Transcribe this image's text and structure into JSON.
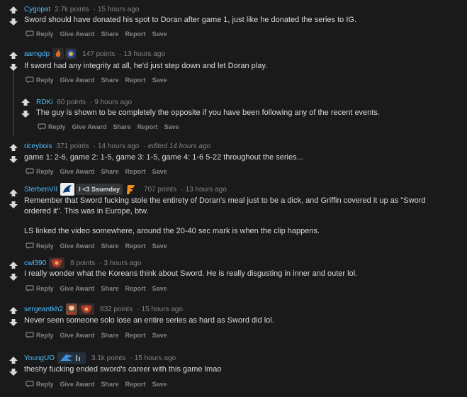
{
  "action_labels": [
    "Reply",
    "Give Award",
    "Share",
    "Report",
    "Save"
  ],
  "colors": {
    "bg": "#1a1a1b",
    "author": "#4fbcff",
    "meta": "#818384",
    "text": "#d7dadc"
  },
  "comments": [
    {
      "author": "Cygopat",
      "points": "2.7k points",
      "time": "15 hours ago",
      "text": "Sword should have donated his spot to Doran after game 1, just like he donated the series to IG.",
      "flairs": []
    },
    {
      "author": "aamgdp",
      "points": "147 points",
      "time": "13 hours ago",
      "text": "If sword had any integrity at all, he'd just step down and let Doran play.",
      "flairs": [
        "fire-team-icon",
        "blue-team-icon"
      ]
    },
    {
      "author": "RDKi",
      "points": "60 points",
      "time": "9 hours ago",
      "text": "The guy is shown to be completely the opposite if you have been following any of the recent events.",
      "flairs": []
    },
    {
      "author": "riceybois",
      "points": "371 points",
      "time": "14 hours ago",
      "edited": "edited 14 hours ago",
      "text": "game 1: 2-6, game 2: 1-5, game 3: 1-5, game 4: 1-6 5-22 throughout the series...",
      "flairs": []
    },
    {
      "author": "SterbenVII",
      "points": "707 points",
      "time": "13 hours ago",
      "flair_text": "I <3 Ssumday",
      "text": "Remember that Sword fucking stole the entirety of Doran's meal just to be a dick, and Griffin covered it up as \"Sword",
      "text2": "ordered it\". This was in Europe, btw.",
      "text3": "LS linked the video somewhere, around the 20-40 sec mark is when the clip happens.",
      "flairs": [
        "liquid-icon",
        "fnatic-icon"
      ]
    },
    {
      "author": "cwl390",
      "points": "8 points",
      "time": "3 hours ago",
      "text": "I really wonder what the Koreans think about Sword. He is really disgusting in inner and outer lol.",
      "flairs": [
        "lck-icon"
      ]
    },
    {
      "author": "sergeantkh2",
      "points": "832 points",
      "time": "15 hours ago",
      "text": "Never seen someone solo lose an entire series as hard as Sword did lol.",
      "flairs": [
        "champion-icon",
        "lck-icon"
      ]
    },
    {
      "author": "YoungUO",
      "points": "3.1k points",
      "time": "15 hours ago",
      "text": "theshy fucking ended sword's career with this game lmao",
      "flairs": [
        "edg-icon"
      ]
    }
  ]
}
